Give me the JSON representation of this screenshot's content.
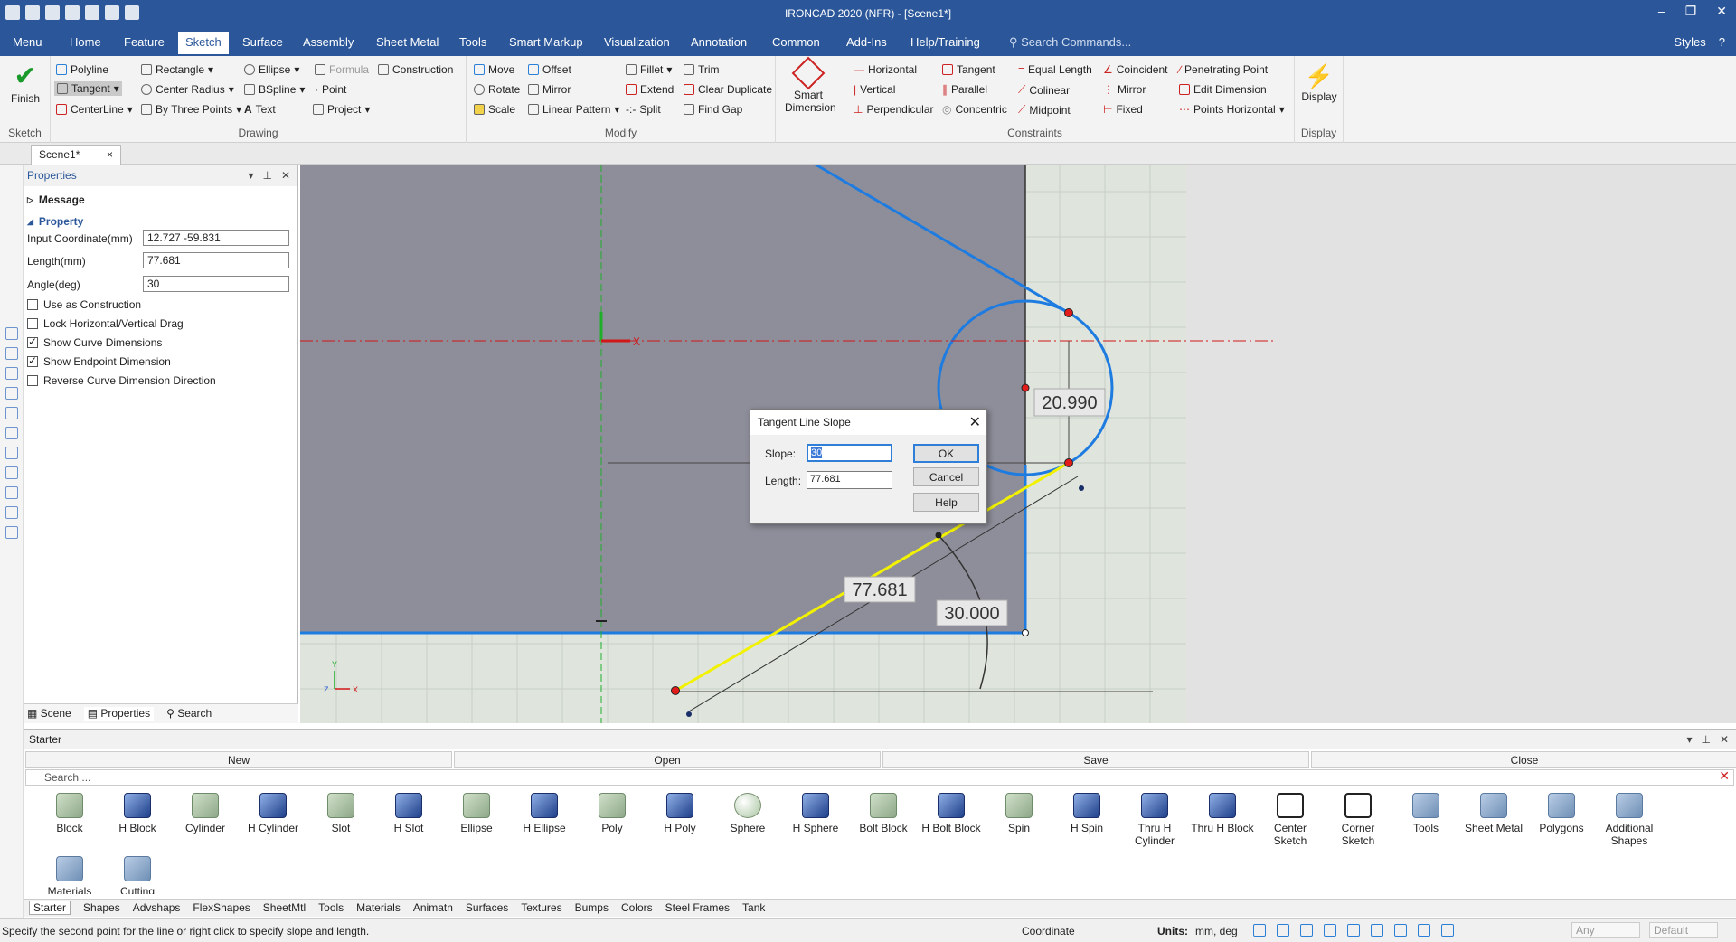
{
  "titlebar": {
    "title": "IRONCAD 2020 (NFR) - [Scene1*]",
    "minimize": "–",
    "restore": "❐",
    "close": "✕"
  },
  "menu": {
    "tabs": [
      "Menu",
      "Home",
      "Feature",
      "Sketch",
      "Surface",
      "Assembly",
      "Sheet Metal",
      "Tools",
      "Smart Markup",
      "Visualization",
      "Annotation",
      "Common",
      "Add-Ins",
      "Help/Training"
    ],
    "active": "Sketch",
    "search_placeholder": "Search Commands...",
    "styles": "Styles"
  },
  "ribbon": {
    "finish": "Finish",
    "sketch_group": "Sketch",
    "drawing": {
      "label": "Drawing",
      "polyline": "Polyline",
      "rectangle": "Rectangle",
      "ellipse": "Ellipse",
      "formula": "Formula",
      "construction": "Construction",
      "tangent": "Tangent",
      "center_radius": "Center Radius",
      "bspline": "BSpline",
      "point": "Point",
      "centerline": "CenterLine",
      "by_three_points": "By Three Points",
      "text": "Text",
      "project": "Project"
    },
    "modify": {
      "label": "Modify",
      "move": "Move",
      "offset": "Offset",
      "fillet": "Fillet",
      "trim": "Trim",
      "rotate": "Rotate",
      "mirror": "Mirror",
      "extend": "Extend",
      "clear_duplicate": "Clear Duplicate",
      "scale": "Scale",
      "linear_pattern": "Linear Pattern",
      "split": "Split",
      "find_gap": "Find Gap"
    },
    "constraints": {
      "label": "Constraints",
      "smart_dimension_1": "Smart",
      "smart_dimension_2": "Dimension",
      "horizontal": "Horizontal",
      "tangent": "Tangent",
      "equal_length": "Equal Length",
      "coincident": "Coincident",
      "penetrating_point": "Penetrating Point",
      "vertical": "Vertical",
      "parallel": "Parallel",
      "colinear": "Colinear",
      "mirror": "Mirror",
      "edit_dimension": "Edit Dimension",
      "perpendicular": "Perpendicular",
      "concentric": "Concentric",
      "midpoint": "Midpoint",
      "fixed": "Fixed",
      "points_horizontal": "Points Horizontal"
    },
    "display": {
      "label": "Display",
      "button": "Display"
    }
  },
  "doc_tab": {
    "name": "Scene1*",
    "close": "×"
  },
  "properties": {
    "title": "Properties",
    "message_section": "Message",
    "property_section": "Property",
    "input_coordinate_label": "Input Coordinate(mm)",
    "input_coordinate_value": "12.727 -59.831",
    "length_label": "Length(mm)",
    "length_value": "77.681",
    "angle_label": "Angle(deg)",
    "angle_value": "30",
    "checks": [
      {
        "label": "Use as Construction",
        "checked": false
      },
      {
        "label": "Lock Horizontal/Vertical Drag",
        "checked": false
      },
      {
        "label": "Show Curve Dimensions",
        "checked": true
      },
      {
        "label": "Show Endpoint Dimension",
        "checked": true
      },
      {
        "label": "Reverse Curve Dimension Direction",
        "checked": false
      }
    ],
    "tabs": [
      "Scene",
      "Properties",
      "Search"
    ]
  },
  "canvas": {
    "dim_radius": "20.990",
    "dim_length": "77.681",
    "dim_angle": "30.000",
    "axis_x": "X",
    "axis_y": "Y",
    "axis_z": "Z"
  },
  "dialog": {
    "title": "Tangent Line Slope",
    "slope_label": "Slope:",
    "slope_value": "30",
    "length_label": "Length:",
    "length_value": "77.681",
    "ok": "OK",
    "cancel": "Cancel",
    "help": "Help"
  },
  "catalog": {
    "title": "Starter",
    "new": "New",
    "open": "Open",
    "save": "Save",
    "close": "Close",
    "search_placeholder": "Search ...",
    "items": [
      {
        "label": "Block",
        "icon": "solid"
      },
      {
        "label": "H Block",
        "icon": "hole"
      },
      {
        "label": "Cylinder",
        "icon": "solid"
      },
      {
        "label": "H Cylinder",
        "icon": "hole"
      },
      {
        "label": "Slot",
        "icon": "solid"
      },
      {
        "label": "H Slot",
        "icon": "hole"
      },
      {
        "label": "Ellipse",
        "icon": "solid"
      },
      {
        "label": "H Ellipse",
        "icon": "hole"
      },
      {
        "label": "Poly",
        "icon": "solid"
      },
      {
        "label": "H Poly",
        "icon": "hole"
      },
      {
        "label": "Sphere",
        "icon": "sphere"
      },
      {
        "label": "H Sphere",
        "icon": "hole"
      },
      {
        "label": "Bolt Block",
        "icon": "solid"
      },
      {
        "label": "H Bolt Block",
        "icon": "hole"
      },
      {
        "label": "Spin",
        "icon": "solid"
      },
      {
        "label": "H Spin",
        "icon": "hole"
      },
      {
        "label": "Thru H Cylinder",
        "icon": "hole"
      },
      {
        "label": "Thru H Block",
        "icon": "hole"
      },
      {
        "label": "Center Sketch",
        "icon": "box"
      },
      {
        "label": "Corner Sketch",
        "icon": "box"
      },
      {
        "label": "Tools",
        "icon": "folder"
      },
      {
        "label": "Sheet Metal",
        "icon": "folder"
      },
      {
        "label": "Polygons",
        "icon": "folder"
      },
      {
        "label": "Additional Shapes",
        "icon": "folder"
      },
      {
        "label": "Materials",
        "icon": "folder"
      },
      {
        "label": "Cutting",
        "icon": "folder"
      }
    ],
    "tabs": [
      "Starter",
      "Shapes",
      "Advshaps",
      "FlexShapes",
      "SheetMtl",
      "Tools",
      "Materials",
      "Animatn",
      "Surfaces",
      "Textures",
      "Bumps",
      "Colors",
      "Steel Frames",
      "Tank"
    ]
  },
  "status": {
    "message": "Specify the second point for the line or right click to specify slope and length.",
    "coordinate": "Coordinate",
    "units_label": "Units:",
    "units_value": "mm, deg",
    "combo1": "Any",
    "combo2": "Default"
  },
  "colors": {
    "accent": "#2b579a",
    "sketch_blue": "#1e7be0",
    "highlight_yellow": "#f2f200",
    "centerline_red": "#d01818"
  }
}
